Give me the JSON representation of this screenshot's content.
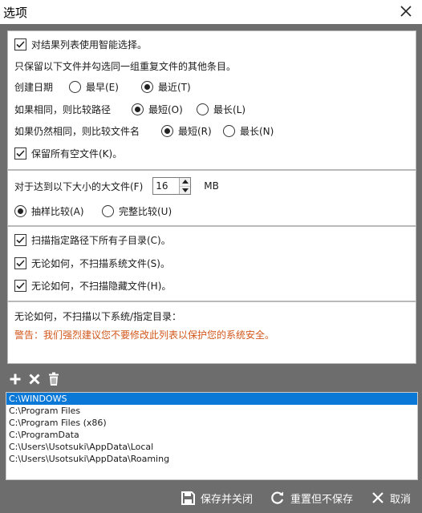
{
  "window": {
    "title": "选项"
  },
  "section1": {
    "smart_select_label": "对结果列表使用智能选择。",
    "description": "只保留以下文件并勾选同一组重复文件的其他条目。",
    "create_date_label": "创建日期",
    "earliest_label": "最早(E)",
    "latest_label": "最近(T)",
    "same_path_label": "如果相同，则比较路径",
    "path_shortest_label": "最短(O)",
    "path_longest_label": "最长(L)",
    "same_name_label": "如果仍然相同，则比较文件名",
    "name_shortest_label": "最短(R)",
    "name_longest_label": "最长(N)",
    "keep_empty_label": "保留所有空文件(K)。"
  },
  "section2": {
    "large_file_label": "对于达到以下大小的大文件(F)",
    "size_value": "16",
    "unit": "MB",
    "sample_compare_label": "抽样比较(A)",
    "full_compare_label": "完整比较(U)"
  },
  "section3": {
    "scan_subdirs_label": "扫描指定路径下所有子目录(C)。",
    "skip_system_label": "无论如何，不扫描系统文件(S)。",
    "skip_hidden_label": "无论如何，不扫描隐藏文件(H)。"
  },
  "section4": {
    "exclude_title": "无论如何，不扫描以下系统/指定目录：",
    "warning": "警告：我们强烈建议您不要修改此列表以保护您的系统安全。"
  },
  "toolbar": {
    "add_icon": "plus-icon",
    "remove_icon": "x-icon",
    "delete_icon": "trash-icon"
  },
  "excluded_dirs": [
    "C:\\WINDOWS",
    "C:\\Program Files",
    "C:\\Program Files (x86)",
    "C:\\ProgramData",
    "C:\\Users\\Usotsuki\\AppData\\Local",
    "C:\\Users\\Usotsuki\\AppData\\Roaming"
  ],
  "footer": {
    "save_close_label": "保存并关闭",
    "reset_label": "重置但不保存",
    "cancel_label": "取消"
  },
  "colors": {
    "background": "#6d6d6d",
    "selection": "#0a78d7",
    "warning": "#d2571c"
  }
}
